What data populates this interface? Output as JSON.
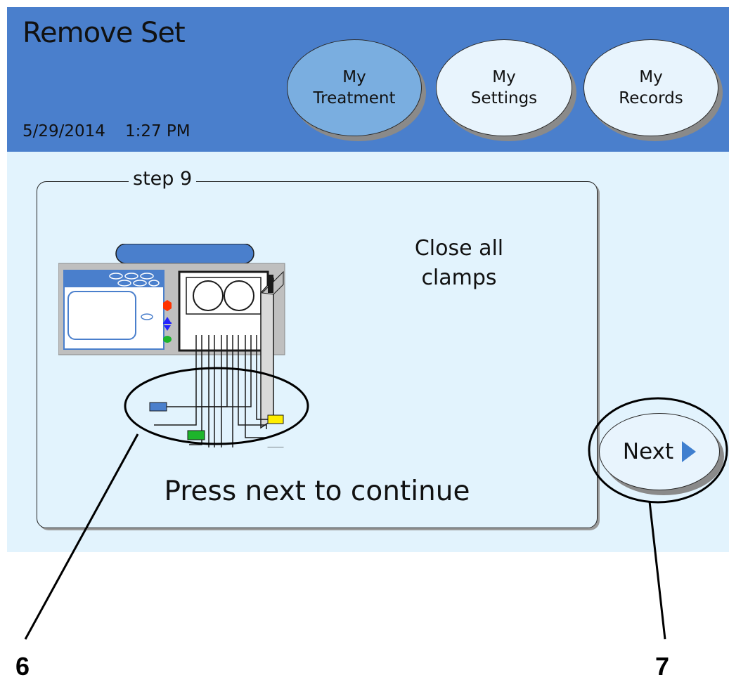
{
  "header": {
    "title": "Remove Set",
    "date": "5/29/2014",
    "time": "1:27 PM",
    "tabs": [
      {
        "label": "My\nTreatment",
        "active": true
      },
      {
        "label": "My\nSettings",
        "active": false
      },
      {
        "label": "My\nRecords",
        "active": false
      }
    ]
  },
  "step": {
    "label": "step 9",
    "instruction": "Close all\nclamps",
    "prompt": "Press next to continue"
  },
  "next_button": {
    "label": "Next",
    "icon": "right-triangle-icon"
  },
  "callouts": [
    "6",
    "7"
  ],
  "colors": {
    "header_bg": "#4a7fcc",
    "screen_bg": "#e2f3fd",
    "active_tab": "#7aaee0",
    "arrow": "#3f7fcf",
    "clamp_blue": "#4a7fcc",
    "clamp_green": "#1db52b",
    "clamp_yellow": "#ffee00",
    "clamp_red": "#ff3300"
  }
}
